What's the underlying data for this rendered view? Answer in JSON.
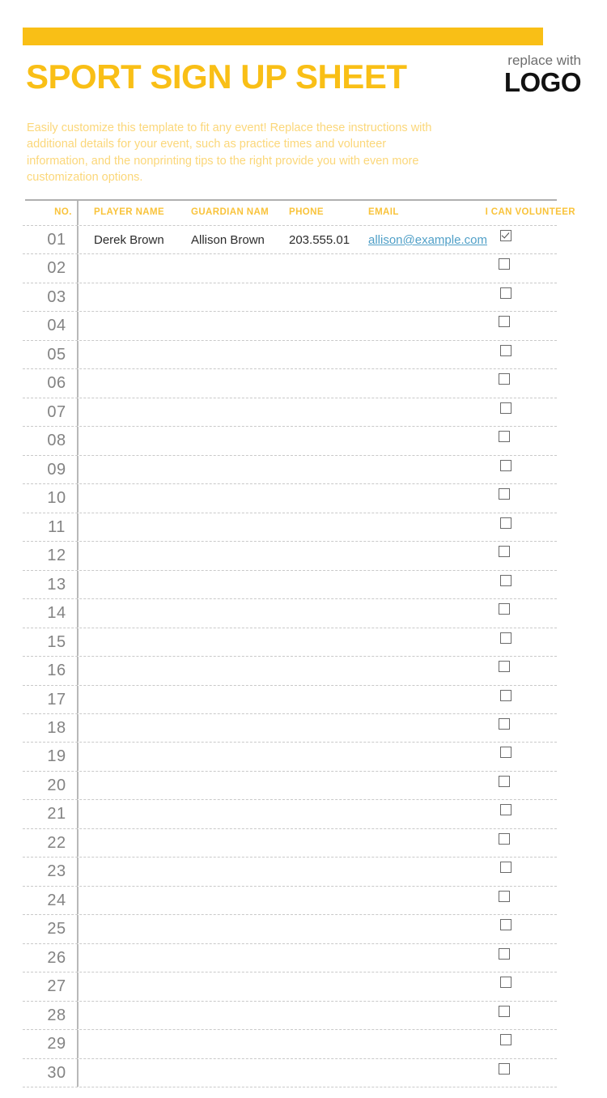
{
  "document": {
    "title": "SPORT SIGN UP SHEET",
    "accent_color": "#f9bf16",
    "intro": "Easily customize this template to fit any event! Replace these instructions with additional details for your event, such as practice times and volunteer information, and the nonprinting tips to the right provide you with even more customization options."
  },
  "logo": {
    "line1": "replace with",
    "line2": "LOGO"
  },
  "table": {
    "headers": {
      "no": "NO.",
      "player_name": "PLAYER NAME",
      "guardian_name": "GUARDIAN NAM",
      "phone": "PHONE",
      "email": "EMAIL",
      "volunteer": "I CAN VOLUNTEER"
    },
    "rows": [
      {
        "no": "01",
        "player_name": "Derek Brown",
        "guardian_name": "Allison Brown",
        "phone": "203.555.01",
        "email": "allison@example.com",
        "volunteer": true
      },
      {
        "no": "02",
        "player_name": "",
        "guardian_name": "",
        "phone": "",
        "email": "",
        "volunteer": false
      },
      {
        "no": "03",
        "player_name": "",
        "guardian_name": "",
        "phone": "",
        "email": "",
        "volunteer": false
      },
      {
        "no": "04",
        "player_name": "",
        "guardian_name": "",
        "phone": "",
        "email": "",
        "volunteer": false
      },
      {
        "no": "05",
        "player_name": "",
        "guardian_name": "",
        "phone": "",
        "email": "",
        "volunteer": false
      },
      {
        "no": "06",
        "player_name": "",
        "guardian_name": "",
        "phone": "",
        "email": "",
        "volunteer": false
      },
      {
        "no": "07",
        "player_name": "",
        "guardian_name": "",
        "phone": "",
        "email": "",
        "volunteer": false
      },
      {
        "no": "08",
        "player_name": "",
        "guardian_name": "",
        "phone": "",
        "email": "",
        "volunteer": false
      },
      {
        "no": "09",
        "player_name": "",
        "guardian_name": "",
        "phone": "",
        "email": "",
        "volunteer": false
      },
      {
        "no": "10",
        "player_name": "",
        "guardian_name": "",
        "phone": "",
        "email": "",
        "volunteer": false
      },
      {
        "no": "11",
        "player_name": "",
        "guardian_name": "",
        "phone": "",
        "email": "",
        "volunteer": false
      },
      {
        "no": "12",
        "player_name": "",
        "guardian_name": "",
        "phone": "",
        "email": "",
        "volunteer": false
      },
      {
        "no": "13",
        "player_name": "",
        "guardian_name": "",
        "phone": "",
        "email": "",
        "volunteer": false
      },
      {
        "no": "14",
        "player_name": "",
        "guardian_name": "",
        "phone": "",
        "email": "",
        "volunteer": false
      },
      {
        "no": "15",
        "player_name": "",
        "guardian_name": "",
        "phone": "",
        "email": "",
        "volunteer": false
      },
      {
        "no": "16",
        "player_name": "",
        "guardian_name": "",
        "phone": "",
        "email": "",
        "volunteer": false
      },
      {
        "no": "17",
        "player_name": "",
        "guardian_name": "",
        "phone": "",
        "email": "",
        "volunteer": false
      },
      {
        "no": "18",
        "player_name": "",
        "guardian_name": "",
        "phone": "",
        "email": "",
        "volunteer": false
      },
      {
        "no": "19",
        "player_name": "",
        "guardian_name": "",
        "phone": "",
        "email": "",
        "volunteer": false
      },
      {
        "no": "20",
        "player_name": "",
        "guardian_name": "",
        "phone": "",
        "email": "",
        "volunteer": false
      },
      {
        "no": "21",
        "player_name": "",
        "guardian_name": "",
        "phone": "",
        "email": "",
        "volunteer": false
      },
      {
        "no": "22",
        "player_name": "",
        "guardian_name": "",
        "phone": "",
        "email": "",
        "volunteer": false
      },
      {
        "no": "23",
        "player_name": "",
        "guardian_name": "",
        "phone": "",
        "email": "",
        "volunteer": false
      },
      {
        "no": "24",
        "player_name": "",
        "guardian_name": "",
        "phone": "",
        "email": "",
        "volunteer": false
      },
      {
        "no": "25",
        "player_name": "",
        "guardian_name": "",
        "phone": "",
        "email": "",
        "volunteer": false
      },
      {
        "no": "26",
        "player_name": "",
        "guardian_name": "",
        "phone": "",
        "email": "",
        "volunteer": false
      },
      {
        "no": "27",
        "player_name": "",
        "guardian_name": "",
        "phone": "",
        "email": "",
        "volunteer": false
      },
      {
        "no": "28",
        "player_name": "",
        "guardian_name": "",
        "phone": "",
        "email": "",
        "volunteer": false
      },
      {
        "no": "29",
        "player_name": "",
        "guardian_name": "",
        "phone": "",
        "email": "",
        "volunteer": false
      },
      {
        "no": "30",
        "player_name": "",
        "guardian_name": "",
        "phone": "",
        "email": "",
        "volunteer": false
      }
    ]
  }
}
